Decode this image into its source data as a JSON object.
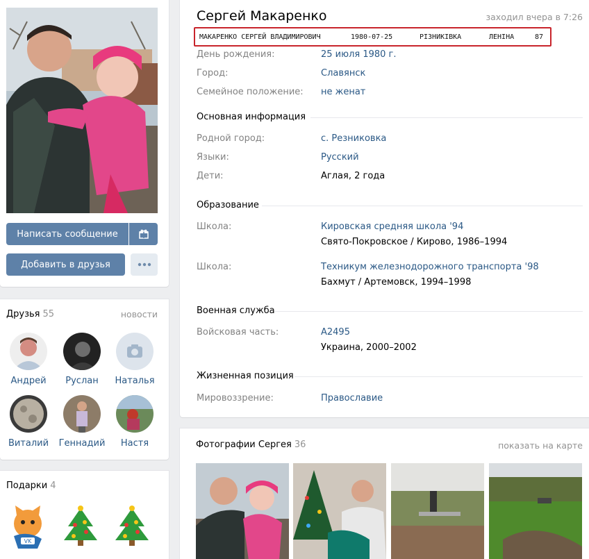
{
  "profile": {
    "name": "Сергей Макаренко",
    "last_seen": "заходил вчера в 7:26",
    "record": {
      "fullname": "МАКАРЕНКО СЕРГЕЙ ВЛАДИМИРОВИЧ",
      "date": "1980-07-25",
      "village": "РІЗНИКІВКА",
      "street": "ЛЕНІНА",
      "house": "87"
    },
    "birthday_label": "День рождения:",
    "birthday": "25 июля 1980 г.",
    "city_label": "Город:",
    "city": "Славянск",
    "family_label": "Семейное положение:",
    "family": "не женат",
    "main_info": "Основная информация",
    "hometown_label": "Родной город:",
    "hometown": "с. Резниковка",
    "langs_label": "Языки:",
    "langs": "Русский",
    "kids_label": "Дети:",
    "kids": "Аглая, 2 года",
    "education": "Образование",
    "school_label": "Школа:",
    "school1_name": "Кировская средняя школа '94",
    "school1_detail": "Свято-Покровское / Кирово, 1986–1994",
    "school2_label": "Школа:",
    "school2_name": "Техникум железнодорожного транспорта '98",
    "school2_detail": "Бахмут / Артемовск, 1994–1998",
    "military": "Военная служба",
    "unit_label": "Войсковая часть:",
    "unit": "А2495",
    "unit_detail": "Украина, 2000–2002",
    "life": "Жизненная позиция",
    "worldview_label": "Мировоззрение:",
    "worldview": "Православие"
  },
  "actions": {
    "message": "Написать сообщение",
    "add_friend": "Добавить в друзья",
    "gift_icon": "gift-icon",
    "more_icon": "more-icon"
  },
  "friends": {
    "title": "Друзья",
    "count": "55",
    "news": "новости",
    "items": [
      {
        "name": "Андрей"
      },
      {
        "name": "Руслан"
      },
      {
        "name": "Наталья"
      },
      {
        "name": "Виталий"
      },
      {
        "name": "Геннадий"
      },
      {
        "name": "Настя"
      }
    ]
  },
  "gifts": {
    "title": "Подарки",
    "count": "4"
  },
  "photos": {
    "title": "Фотографии Сергея",
    "count": "36",
    "map_link": "показать на карте"
  },
  "colors": {
    "accent": "#5e81a8",
    "link": "#2a5885",
    "highlight_border": "#c8242b"
  }
}
